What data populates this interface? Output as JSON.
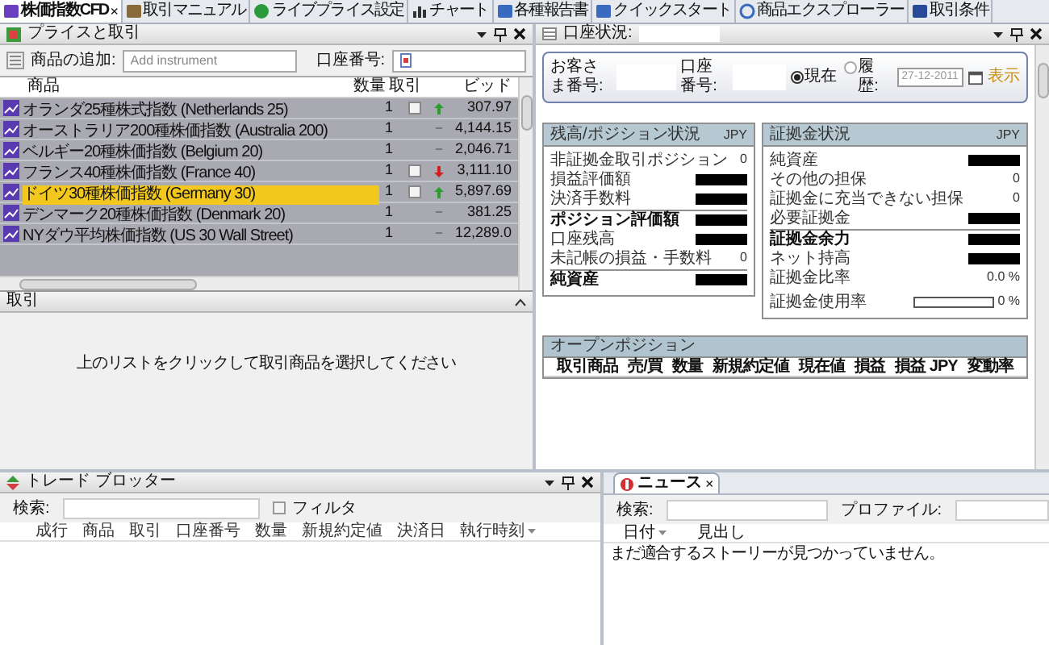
{
  "top_tabs": [
    {
      "label": "株価指数CFD",
      "selected": true,
      "close": "×"
    },
    {
      "label": "取引マニュアル",
      "selected": false
    },
    {
      "label": "ライブプライス設定",
      "selected": false
    },
    {
      "label": "チャート",
      "selected": false
    },
    {
      "label": "各種報告書",
      "selected": false
    },
    {
      "label": "クイックスタート",
      "selected": false
    },
    {
      "label": "商品エクスプローラー",
      "selected": false
    },
    {
      "label": "取引条件",
      "selected": false
    }
  ],
  "price_panel": {
    "title": "プライスと取引",
    "add_label": "商品の追加:",
    "add_placeholder": "Add instrument",
    "account_label": "口座番号:",
    "columns": [
      "商品",
      "数量",
      "取引",
      "ビッド"
    ],
    "rows": [
      {
        "name": "オランダ25種株式指数 (Netherlands 25)",
        "qty": "1",
        "checked": false,
        "kind": "up",
        "bid": "307.97",
        "selected": false
      },
      {
        "name": "オーストラリア200種株価指数 (Australia 200)",
        "qty": "1",
        "kind": "flat",
        "bid": "4,144.15",
        "selected": false
      },
      {
        "name": "ベルギー20種株価指数 (Belgium 20)",
        "qty": "1",
        "kind": "flat",
        "bid": "2,046.71",
        "selected": false
      },
      {
        "name": "フランス40種株価指数 (France 40)",
        "qty": "1",
        "checked": false,
        "kind": "down",
        "bid": "3,111.10",
        "selected": false
      },
      {
        "name": "ドイツ30種株価指数 (Germany 30)",
        "qty": "1",
        "checked": false,
        "kind": "up",
        "bid": "5,897.69",
        "selected": true
      },
      {
        "name": "デンマーク20種株価指数 (Denmark 20)",
        "qty": "1",
        "kind": "flat",
        "bid": "381.25",
        "selected": false
      },
      {
        "name": "NYダウ平均株価指数 (US 30 Wall Street)",
        "qty": "1",
        "kind": "flat",
        "bid": "12,289.0",
        "selected": false
      }
    ]
  },
  "trade_panel": {
    "title": "取引",
    "message": "上のリストをクリックして取引商品を選択してください"
  },
  "account_panel": {
    "title": "口座状況:",
    "customer_label": "お客さま番号:",
    "account_label": "口座番号:",
    "modes": [
      {
        "label": "現在",
        "selected": true
      },
      {
        "label": "履歴:",
        "selected": false
      }
    ],
    "date": "27-12-2011",
    "show_button": "表示",
    "balance_box": {
      "title": "残高/ポジション状況",
      "currency": "JPY",
      "rows": [
        {
          "label": "非証拠金取引ポジション",
          "kind": "item",
          "value": "0"
        },
        {
          "label": "損益評価額",
          "kind": "item",
          "redacted": true
        },
        {
          "label": "決済手数料",
          "kind": "item",
          "redacted": true
        },
        {
          "label": "ポジション評価額",
          "kind": "total",
          "redacted": true
        },
        {
          "label": "口座残高",
          "kind": "item",
          "redacted": true
        },
        {
          "label": "未記帳の損益・手数料",
          "kind": "item",
          "value": "0"
        },
        {
          "label": "純資産",
          "kind": "total",
          "redacted": true
        }
      ]
    },
    "margin_box": {
      "title": "証拠金状況",
      "currency": "JPY",
      "rows": [
        {
          "label": "純資産",
          "kind": "item",
          "redacted": true
        },
        {
          "label": "その他の担保",
          "kind": "item",
          "value": "0"
        },
        {
          "label": "証拠金に充当できない担保",
          "kind": "item",
          "value": "0"
        },
        {
          "label": "必要証拠金",
          "kind": "item",
          "redacted": true
        },
        {
          "label": "証拠金余力",
          "kind": "total",
          "redacted": true
        },
        {
          "label": "ネット持高",
          "kind": "item",
          "redacted": true
        },
        {
          "label": "証拠金比率",
          "kind": "item",
          "value": "0.0 %"
        },
        {
          "label": "証拠金使用率",
          "kind": "meter",
          "level": 0,
          "value": "0 %"
        }
      ]
    },
    "open_positions": {
      "title": "オープンポジション",
      "columns": [
        "取引商品",
        "売/買",
        "数量",
        "新規約定値",
        "現在値",
        "損益",
        "損益 JPY",
        "変動率"
      ]
    }
  },
  "blotter": {
    "title": "トレード ブロッター",
    "search_label": "検索:",
    "filter": {
      "label": "フィルタ",
      "checked": false
    },
    "columns": [
      "成行",
      "商品",
      "取引",
      "口座番号",
      "数量",
      "新規約定値",
      "決済日",
      "執行時刻"
    ]
  },
  "news": {
    "tab": {
      "label": "ニュース",
      "selected": true,
      "close": "×"
    },
    "search_label": "検索:",
    "profile_label": "プロファイル:",
    "columns": [
      "日付",
      "見出し"
    ],
    "message": "まだ適合するストーリーが見つかっていません。"
  }
}
